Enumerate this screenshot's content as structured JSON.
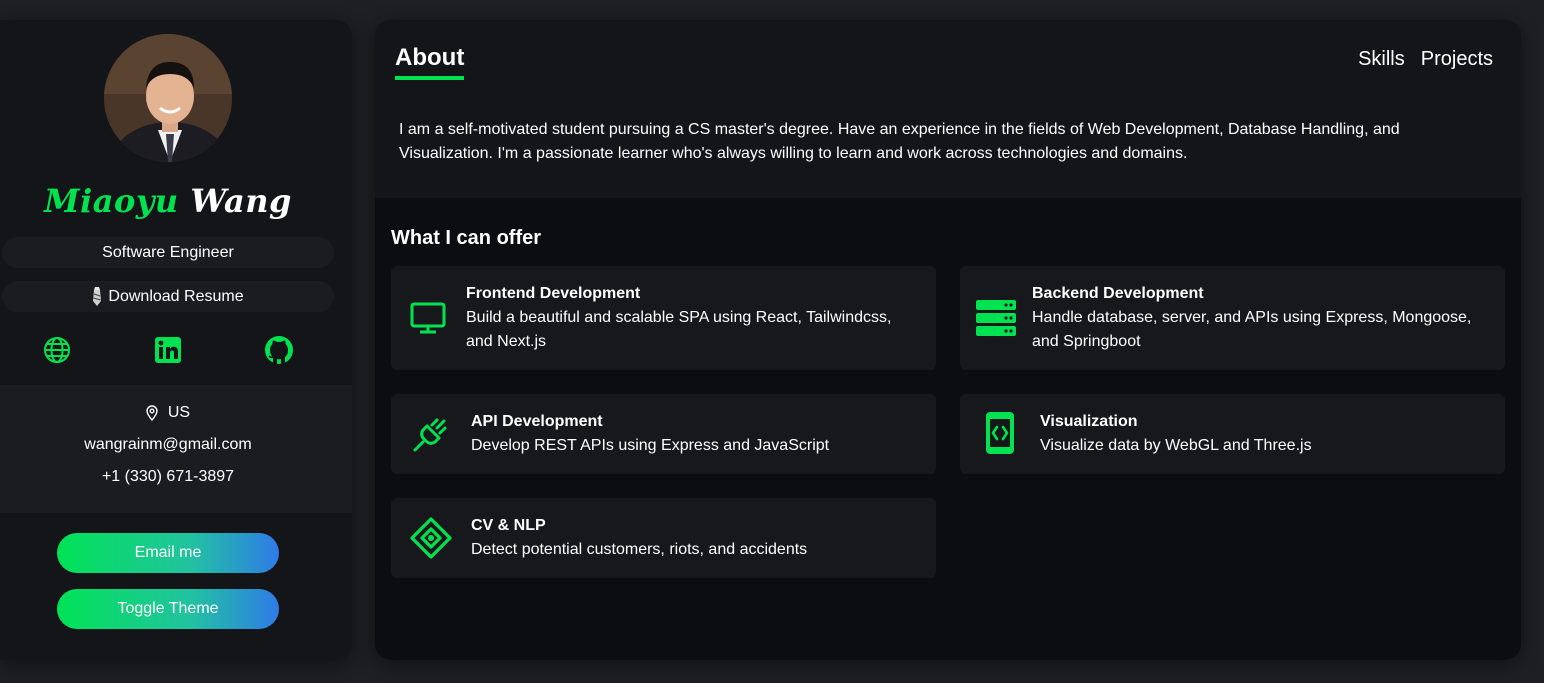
{
  "profile": {
    "first_name": "Miaoyu",
    "last_name": "Wang",
    "role": "Software Engineer",
    "resume_label": "Download Resume",
    "socials": [
      "globe-icon",
      "linkedin-icon",
      "github-icon"
    ],
    "location": "US",
    "email": "wangrainm@gmail.com",
    "phone": "+1 (330) 671-3897"
  },
  "actions": {
    "email_label": "Email me",
    "theme_label": "Toggle Theme"
  },
  "nav": {
    "active": "About",
    "links": [
      "Skills",
      "Projects"
    ]
  },
  "about": {
    "text": "I am a self-motivated student pursuing a CS master's degree. Have an experience in the fields of Web Development, Database Handling, and Visualization. I'm a passionate learner who's always willing to learn and work across technologies and domains."
  },
  "offer": {
    "title": "What I can offer",
    "items": [
      {
        "title": "Frontend Development",
        "desc": "Build a beautiful and scalable SPA using React, Tailwindcss, and Next.js",
        "icon": "monitor-icon"
      },
      {
        "title": "Backend Development",
        "desc": "Handle database, server, and APIs using Express, Mongoose, and Springboot",
        "icon": "server-icon"
      },
      {
        "title": "API Development",
        "desc": "Develop REST APIs using Express and JavaScript",
        "icon": "plug-icon"
      },
      {
        "title": "Visualization",
        "desc": "Visualize data by WebGL and Three.js",
        "icon": "code-device-icon"
      },
      {
        "title": "CV & NLP",
        "desc": "Detect potential customers, riots, and accidents",
        "icon": "diamond-target-icon"
      }
    ]
  },
  "colors": {
    "accent": "#00e351",
    "gradient_end": "#2f7be8",
    "background": "#1e1f22",
    "panel": "#141519",
    "card": "#17181c"
  }
}
